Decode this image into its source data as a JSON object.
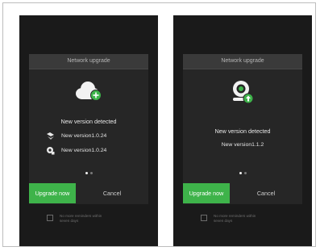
{
  "screens": [
    {
      "header": "Network upgrade",
      "hero_icon": "cloud-plus-icon",
      "detected_text": "New version detected",
      "versions": [
        {
          "icon": "camera-app-icon",
          "text": "New version1.0.24"
        },
        {
          "icon": "gear-app-icon",
          "text": "New version1.0.24"
        }
      ],
      "page_indicator": {
        "count": 2,
        "active": 1
      },
      "primary_button": "Upgrade now",
      "cancel_button": "Cancel",
      "remind_checkbox_label": "No more reminders within seven days"
    },
    {
      "header": "Network upgrade",
      "hero_icon": "device-upgrade-icon",
      "detected_text": "New version detected",
      "version_text": "New version1.1.2",
      "page_indicator": {
        "count": 2,
        "active": 1
      },
      "primary_button": "Upgrade now",
      "cancel_button": "Cancel",
      "remind_checkbox_label": "No more reminders within seven days"
    }
  ],
  "colors": {
    "primary_green": "#3eb34a",
    "dialog_bg": "#262626",
    "screen_bg": "#1a1a1a"
  }
}
